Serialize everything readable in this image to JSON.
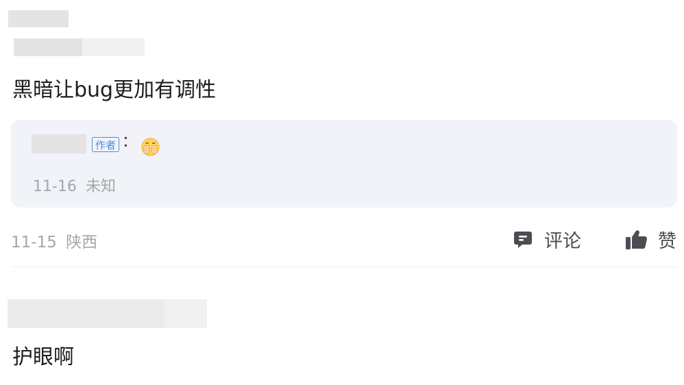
{
  "comment1": {
    "text": "黑暗让bug更加有调性",
    "reply": {
      "author_badge": "作者",
      "colon": "：",
      "emoji_icon": "cover-mouth-emoji-icon",
      "date": "11-16",
      "location": "未知"
    },
    "date": "11-15",
    "location": "陕西",
    "actions": {
      "comment_label": "评论",
      "comment_icon": "comment-icon",
      "like_label": "赞",
      "like_icon": "thumbs-up-icon"
    }
  },
  "comment2": {
    "text": "护眼啊"
  },
  "colors": {
    "badge": "#4a8ae6",
    "meta": "#a4a7ad",
    "icon": "#4a4d52",
    "reply_bg": "#f2f3f8"
  }
}
